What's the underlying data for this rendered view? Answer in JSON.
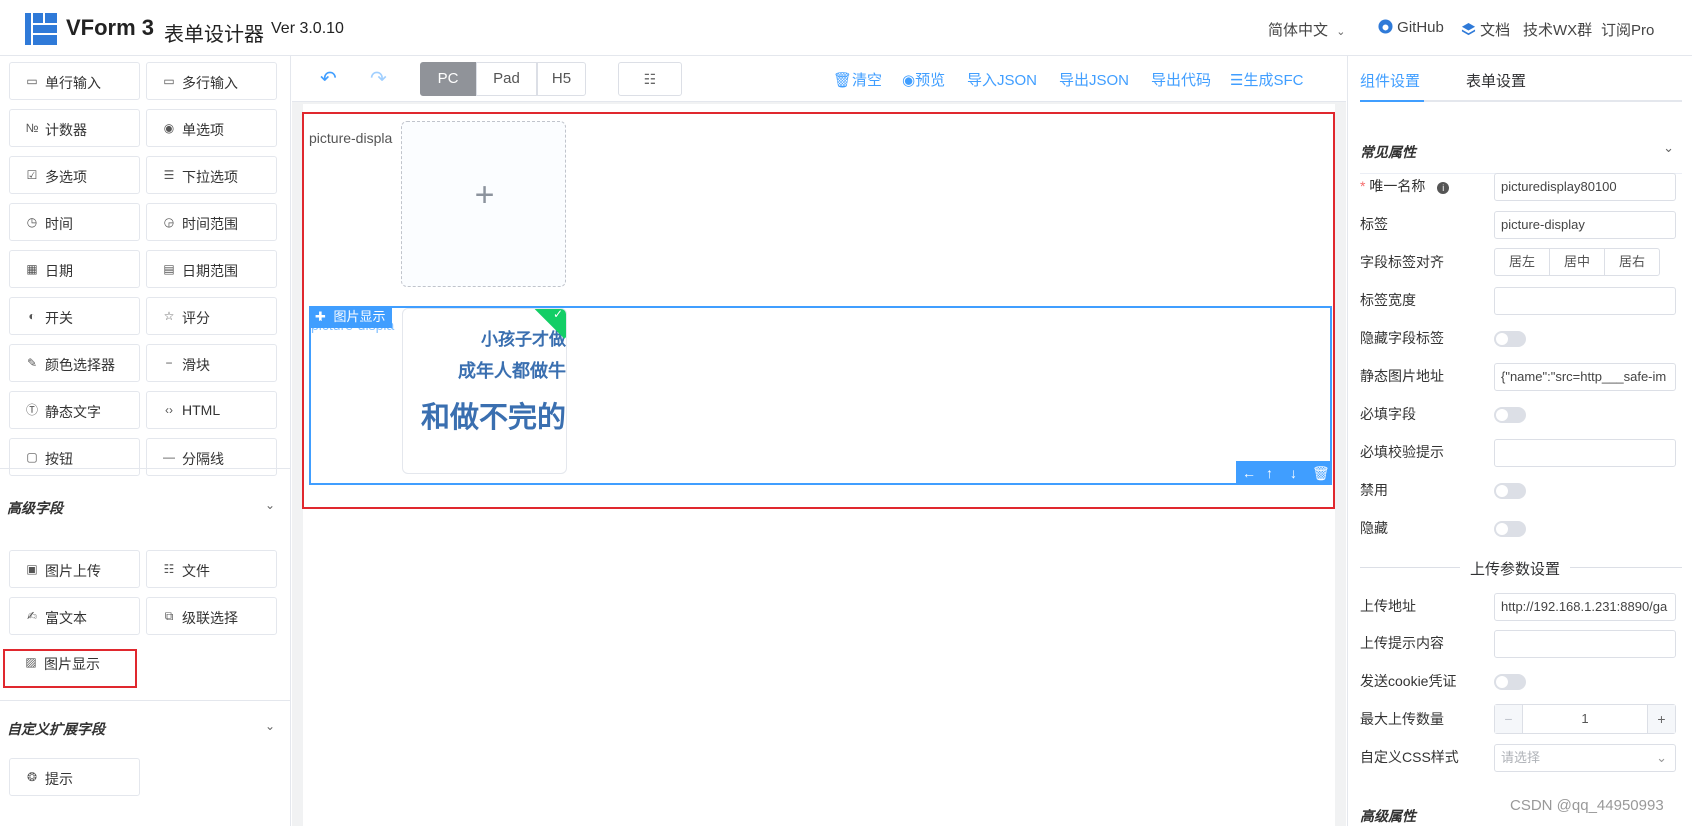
{
  "header": {
    "title": "VForm 3",
    "subtitle": "表单设计器",
    "version": "Ver 3.0.10",
    "lang": "简体中文",
    "github": "GitHub",
    "docs": "文档",
    "wx_group": "技术WX群",
    "subscribe": "订阅Pro"
  },
  "basic_widgets": [
    {
      "icon": "single-line-input-icon",
      "label": "单行输入"
    },
    {
      "icon": "multi-line-input-icon",
      "label": "多行输入"
    },
    {
      "icon": "number-counter-icon",
      "label": "计数器"
    },
    {
      "icon": "radio-icon",
      "label": "单选项"
    },
    {
      "icon": "checkbox-icon",
      "label": "多选项"
    },
    {
      "icon": "select-icon",
      "label": "下拉选项"
    },
    {
      "icon": "time-icon",
      "label": "时间"
    },
    {
      "icon": "time-range-icon",
      "label": "时间范围"
    },
    {
      "icon": "date-icon",
      "label": "日期"
    },
    {
      "icon": "date-range-icon",
      "label": "日期范围"
    },
    {
      "icon": "switch-icon",
      "label": "开关"
    },
    {
      "icon": "star-icon",
      "label": "评分"
    },
    {
      "icon": "color-picker-icon",
      "label": "颜色选择器"
    },
    {
      "icon": "slider-icon",
      "label": "滑块"
    },
    {
      "icon": "static-text-icon",
      "label": "静态文字"
    },
    {
      "icon": "html-icon",
      "label": "HTML"
    },
    {
      "icon": "button-icon",
      "label": "按钮"
    },
    {
      "icon": "divider-icon",
      "label": "分隔线"
    }
  ],
  "advanced_section": {
    "title": "高级字段",
    "widgets": [
      {
        "icon": "picture-upload-icon",
        "label": "图片上传"
      },
      {
        "icon": "file-icon",
        "label": "文件"
      },
      {
        "icon": "rich-text-icon",
        "label": "富文本"
      },
      {
        "icon": "cascader-icon",
        "label": "级联选择"
      },
      {
        "icon": "picture-display-icon",
        "label": "图片显示"
      }
    ]
  },
  "custom_section": {
    "title": "自定义扩展字段",
    "widgets": [
      {
        "icon": "alert-bell-icon",
        "label": "提示"
      }
    ]
  },
  "toolbar": {
    "device_buttons": [
      "PC",
      "Pad",
      "H5"
    ],
    "active_device": "PC",
    "actions": [
      "清空",
      "预览",
      "导入JSON",
      "导出JSON",
      "导出代码",
      "生成SFC"
    ]
  },
  "canvas": {
    "field1_label": "picture-displa",
    "field2_label": "picture-displa",
    "widget_tag": "图片显示",
    "preview_text_lines": [
      "小孩子才做",
      "成年人都做牛",
      "和做不完的"
    ]
  },
  "right_panel": {
    "tabs": [
      "组件设置",
      "表单设置"
    ],
    "active_tab": "组件设置",
    "common_title": "常见属性",
    "props": {
      "unique_name_label": "唯一名称",
      "unique_name_value": "picturedisplay80100",
      "label_label": "标签",
      "label_value": "picture-display",
      "align_label": "字段标签对齐",
      "align_options": [
        "居左",
        "居中",
        "居右"
      ],
      "label_width_label": "标签宽度",
      "hide_label_label": "隐藏字段标签",
      "static_src_label": "静态图片地址",
      "static_src_value": "{\"name\":\"src=http___safe-im",
      "required_label": "必填字段",
      "required_hint_label": "必填校验提示",
      "disabled_label": "禁用",
      "hidden_label": "隐藏",
      "upload_section": "上传参数设置",
      "upload_url_label": "上传地址",
      "upload_url_value": "http://192.168.1.231:8890/ga",
      "upload_tip_label": "上传提示内容",
      "cookie_label": "发送cookie凭证",
      "max_count_label": "最大上传数量",
      "max_count_value": "1",
      "css_label": "自定义CSS样式",
      "css_placeholder": "请选择",
      "advanced_title": "高级属性"
    }
  },
  "watermark": "CSDN @qq_44950993"
}
